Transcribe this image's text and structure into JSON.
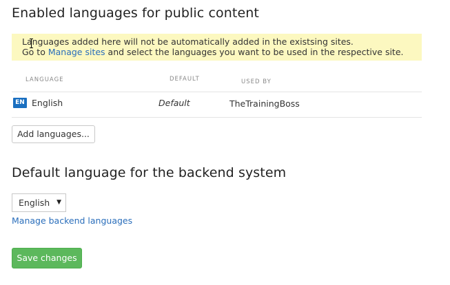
{
  "public_section": {
    "title": "Enabled languages for public content",
    "notice": {
      "line1": "Languages added here will not be automatically added in the existsing sites.",
      "line2_prefix": "Go to ",
      "link": "Manage sites",
      "line2_suffix": " and select the languages you want to be used in the respective site."
    },
    "table": {
      "headers": {
        "language": "LANGUAGE",
        "default": "DEFAULT",
        "used_by": "USED BY"
      },
      "rows": [
        {
          "code": "EN",
          "language": "English",
          "default": "Default",
          "used_by": "TheTrainingBoss"
        }
      ]
    },
    "add_button": "Add languages..."
  },
  "backend_section": {
    "title": "Default language for the backend system",
    "select_value": "English",
    "caret": "▼",
    "manage_link": "Manage backend languages"
  },
  "save_button": "Save changes",
  "colors": {
    "notice_bg": "#fcf8c0",
    "link": "#2a6ebb",
    "badge": "#1a6fc0",
    "save_bg": "#5cb85c"
  }
}
